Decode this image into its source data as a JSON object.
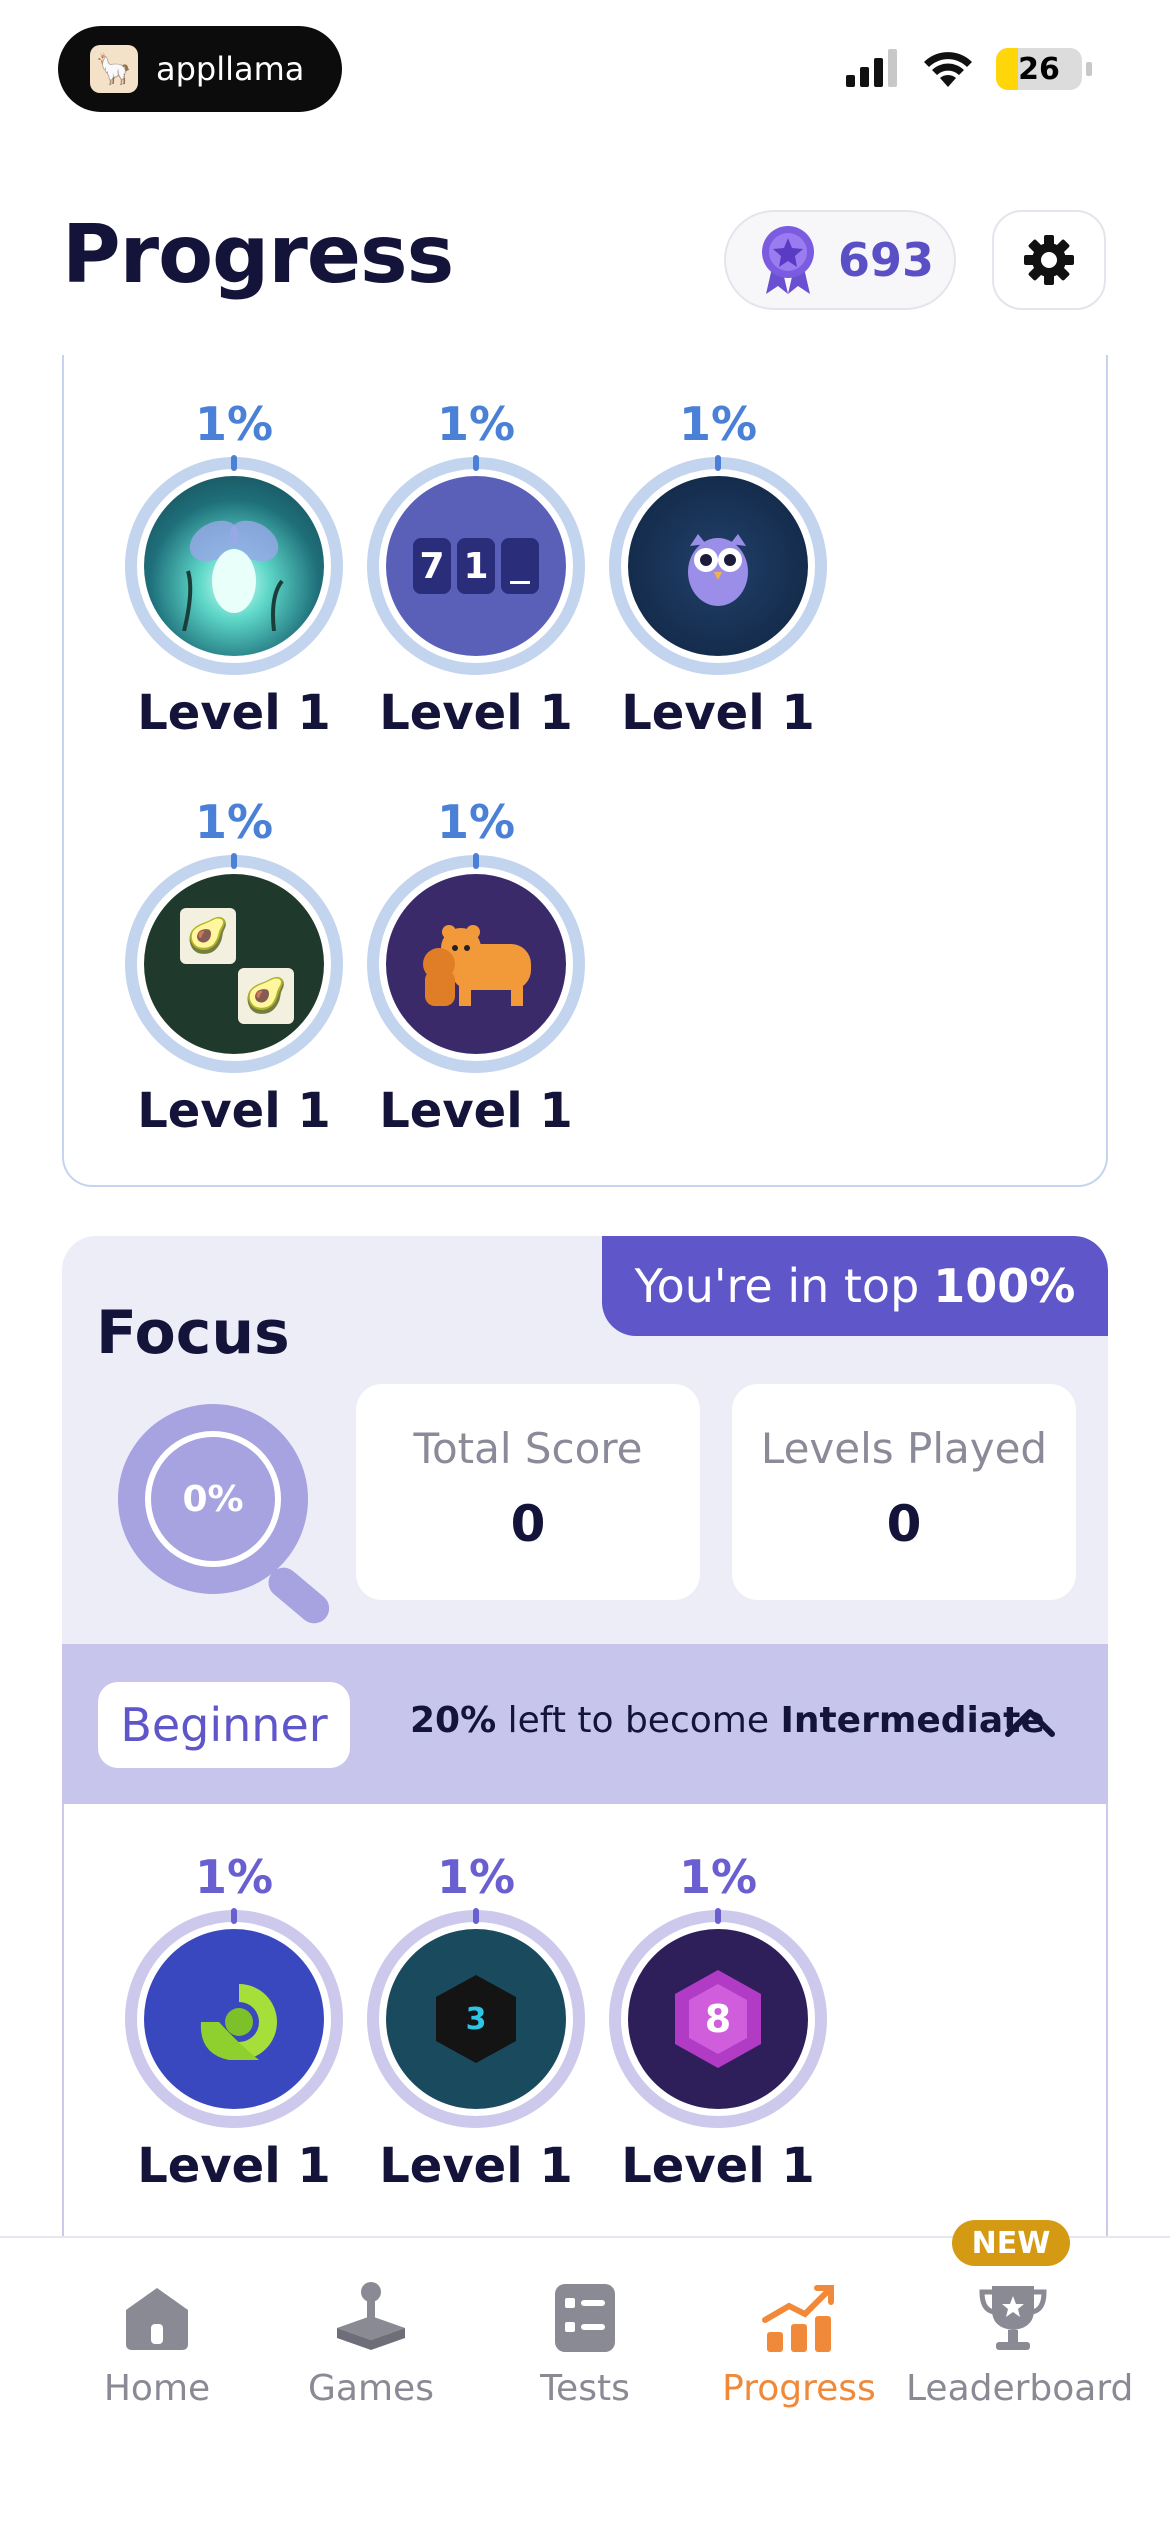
{
  "status_bar": {
    "app_name": "appllama",
    "battery": "26"
  },
  "header": {
    "title": "Progress",
    "gems": "693"
  },
  "memory_games": [
    {
      "id": "firefly",
      "pct": "1%",
      "level": "Level 1"
    },
    {
      "id": "numbers",
      "pct": "1%",
      "level": "Level 1",
      "tiles": [
        "7",
        "1"
      ]
    },
    {
      "id": "owl",
      "pct": "1%",
      "level": "Level 1"
    },
    {
      "id": "avocado",
      "pct": "1%",
      "level": "Level 1"
    },
    {
      "id": "bears",
      "pct": "1%",
      "level": "Level 1"
    }
  ],
  "focus": {
    "title": "Focus",
    "badge_prefix": "You're in top",
    "badge_value": "100%",
    "progress": "0%",
    "total_score_label": "Total Score",
    "total_score_value": "0",
    "levels_played_label": "Levels Played",
    "levels_played_value": "0",
    "tier": "Beginner",
    "tier_msg_pct": "20%",
    "tier_msg_text": "left to become",
    "tier_next": "Intermediate",
    "games": [
      {
        "id": "shell",
        "pct": "1%",
        "level": "Level 1"
      },
      {
        "id": "hexagon",
        "pct": "1%",
        "level": "Level 1",
        "number": "3"
      },
      {
        "id": "gem",
        "pct": "1%",
        "level": "Level 1",
        "number": "8"
      }
    ]
  },
  "nav": {
    "items": [
      {
        "label": "Home"
      },
      {
        "label": "Games"
      },
      {
        "label": "Tests"
      },
      {
        "label": "Progress"
      },
      {
        "label": "Leaderboard"
      }
    ],
    "new_badge": "NEW"
  }
}
